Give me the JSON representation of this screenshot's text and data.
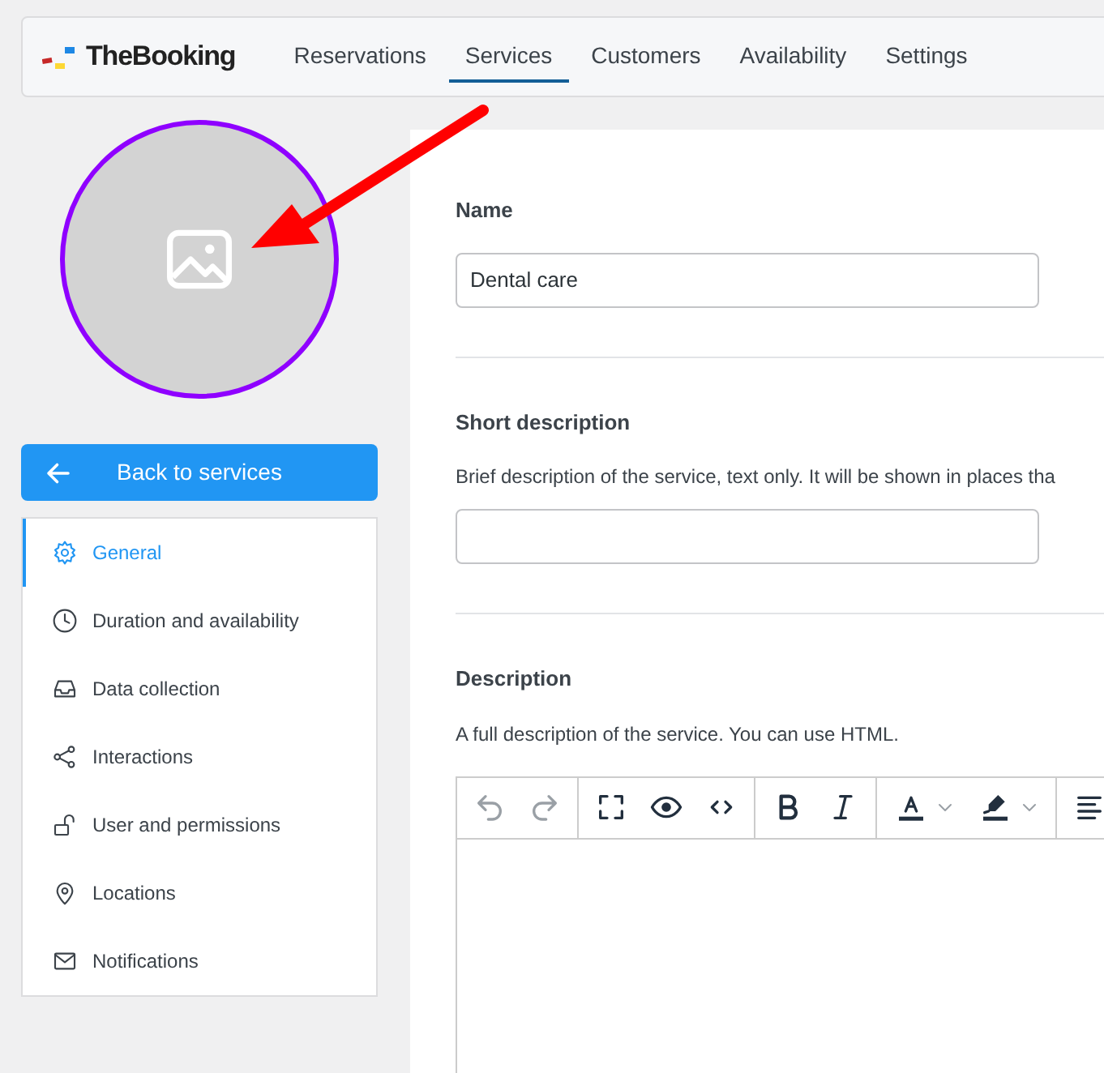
{
  "header": {
    "logo_text": "TheBooking",
    "nav": [
      {
        "label": "Reservations",
        "selected": false
      },
      {
        "label": "Services",
        "selected": true
      },
      {
        "label": "Customers",
        "selected": false
      },
      {
        "label": "Availability",
        "selected": false
      },
      {
        "label": "Settings",
        "selected": false
      }
    ]
  },
  "sidebar": {
    "back_button": "Back to services",
    "items": [
      {
        "label": "General",
        "selected": true
      },
      {
        "label": "Duration and availability",
        "selected": false
      },
      {
        "label": "Data collection",
        "selected": false
      },
      {
        "label": "Interactions",
        "selected": false
      },
      {
        "label": "User and permissions",
        "selected": false
      },
      {
        "label": "Locations",
        "selected": false
      },
      {
        "label": "Notifications",
        "selected": false
      }
    ]
  },
  "form": {
    "sections": [
      {
        "label": "Name",
        "kind": "input",
        "value": "Dental care"
      },
      {
        "label": "Short description",
        "kind": "input",
        "help": "Brief description of the service, text only. It will be shown in places tha"
      },
      {
        "label": "Description",
        "kind": "editor",
        "help": "A full description of the service. You can use HTML."
      }
    ]
  }
}
